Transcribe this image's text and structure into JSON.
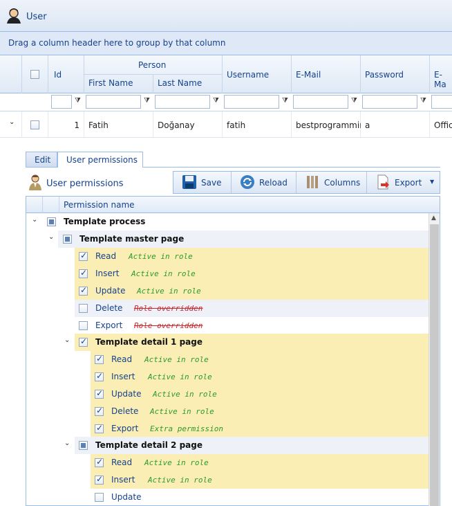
{
  "window": {
    "title": "User"
  },
  "groupbar": {
    "text": "Drag a column header here to group by that column"
  },
  "grid": {
    "headers": {
      "id": "Id",
      "person": "Person",
      "first_name": "First Name",
      "last_name": "Last Name",
      "username": "Username",
      "email": "E-Mail",
      "password": "Password",
      "email2": "E-Ma"
    },
    "row": {
      "id": "1",
      "first_name": "Fatih",
      "last_name": "Doğanay",
      "username": "fatih",
      "email": "bestprogrammin",
      "password": "a",
      "email2": "Offic"
    }
  },
  "tabs": [
    {
      "label": "Edit"
    },
    {
      "label": "User permissions"
    }
  ],
  "panel": {
    "title": "User permissions",
    "toolbar": {
      "save": "Save",
      "reload": "Reload",
      "columns": "Columns",
      "export": "Export"
    },
    "column": "Permission name"
  },
  "permissions": {
    "root": "Template process",
    "master": {
      "name": "Template master page",
      "items": [
        {
          "name": "Read",
          "status": "Active in role"
        },
        {
          "name": "Insert",
          "status": "Active in role"
        },
        {
          "name": "Update",
          "status": "Active in role"
        },
        {
          "name": "Delete",
          "status": "Role overridden"
        },
        {
          "name": "Export",
          "status": "Role overridden"
        }
      ]
    },
    "detail1": {
      "name": "Template detail 1 page",
      "items": [
        {
          "name": "Read",
          "status": "Active in role"
        },
        {
          "name": "Insert",
          "status": "Active in role"
        },
        {
          "name": "Update",
          "status": "Active in role"
        },
        {
          "name": "Delete",
          "status": "Active in role"
        },
        {
          "name": "Export",
          "status": "Extra permission"
        }
      ]
    },
    "detail2": {
      "name": "Template detail 2 page",
      "items": [
        {
          "name": "Read",
          "status": "Active in role"
        },
        {
          "name": "Insert",
          "status": "Active in role"
        },
        {
          "name": "Update",
          "status": ""
        }
      ]
    }
  },
  "colors": {
    "header_text": "#15428b",
    "active": "#2a9a2a",
    "overridden": "#c8282c",
    "highlight": "#fbeeb5"
  }
}
